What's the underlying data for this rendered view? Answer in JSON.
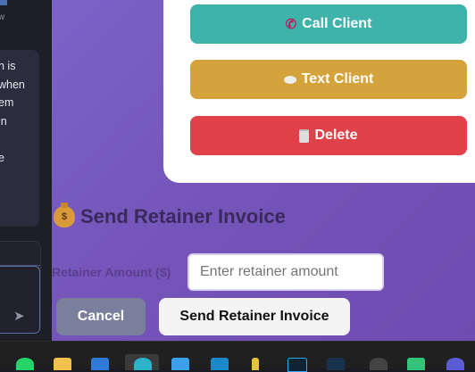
{
  "left_panel": {
    "top_text": "w",
    "message_lines": [
      "n is",
      "when",
      "em",
      "in",
      "",
      "e"
    ]
  },
  "actions": {
    "call_label": "Call Client",
    "text_label": "Text Client",
    "delete_label": "Delete"
  },
  "retainer": {
    "title": "Send Retainer Invoice",
    "amount_label": "Retainer Amount ($)",
    "amount_placeholder": "Enter retainer amount",
    "amount_value": "",
    "cancel_label": "Cancel",
    "send_label": "Send Retainer Invoice"
  },
  "colors": {
    "call": "#3fb2aa",
    "text": "#d4a33c",
    "delete": "#e04048",
    "cancel": "#7a7f9c"
  },
  "taskbar": {
    "icons": [
      "whatsapp-icon",
      "file-explorer-icon",
      "azure-icon",
      "edge-icon",
      "app-icon",
      "outlook-icon",
      "pen-icon",
      "photoshop-icon",
      "app-icon-2",
      "chatgpt-icon",
      "excel-icon",
      "avatar-icon"
    ]
  }
}
